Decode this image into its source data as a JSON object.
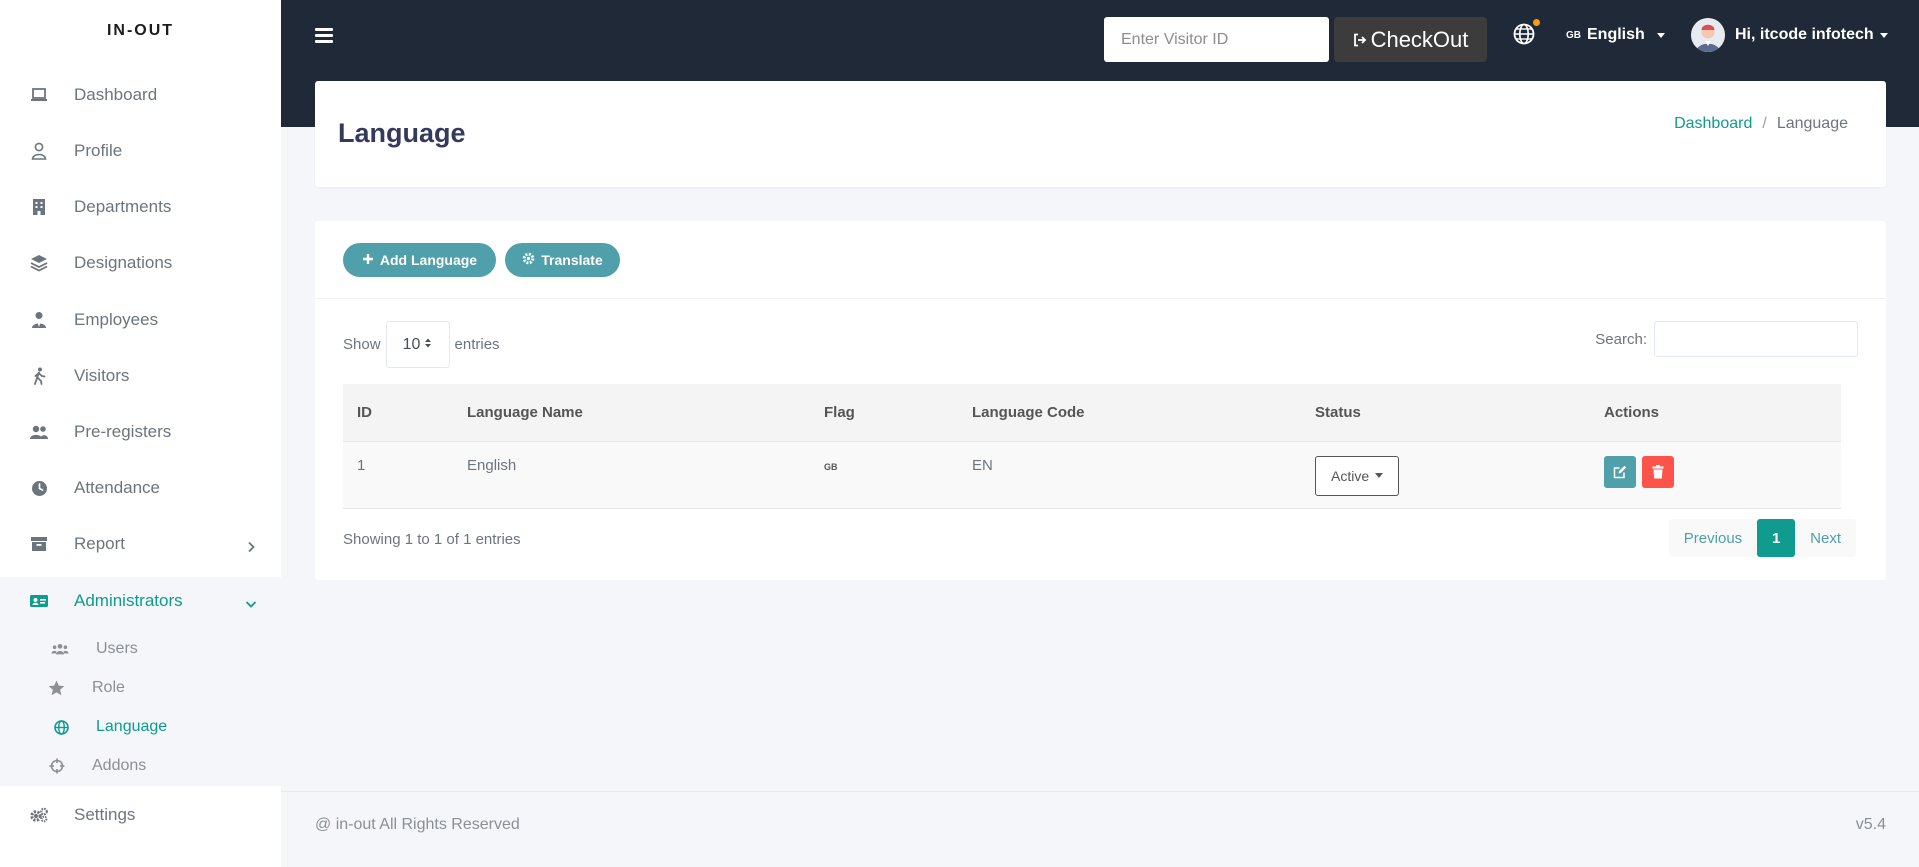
{
  "brand": "IN-OUT",
  "sidebar": {
    "items": [
      {
        "label": "Dashboard",
        "icon": "laptop-icon"
      },
      {
        "label": "Profile",
        "icon": "user-icon"
      },
      {
        "label": "Departments",
        "icon": "building-icon"
      },
      {
        "label": "Designations",
        "icon": "layers-icon"
      },
      {
        "label": "Employees",
        "icon": "user-tie-icon"
      },
      {
        "label": "Visitors",
        "icon": "walking-icon"
      },
      {
        "label": "Pre-registers",
        "icon": "users-icon"
      },
      {
        "label": "Attendance",
        "icon": "clock-icon"
      },
      {
        "label": "Report",
        "icon": "archive-icon"
      },
      {
        "label": "Administrators",
        "icon": "id-card-icon"
      },
      {
        "label": "Settings",
        "icon": "cogs-icon"
      }
    ],
    "sub_items": [
      {
        "label": "Users",
        "icon": "users-icon"
      },
      {
        "label": "Role",
        "icon": "star-icon"
      },
      {
        "label": "Language",
        "icon": "globe-icon"
      },
      {
        "label": "Addons",
        "icon": "crosshairs-icon"
      }
    ]
  },
  "header": {
    "visitor_placeholder": "Enter Visitor ID",
    "checkout_label": "CheckOut",
    "language_flag": "GB",
    "language_label": "English",
    "user_greeting": "Hi, itcode infotech"
  },
  "page": {
    "title": "Language",
    "breadcrumb": {
      "home": "Dashboard",
      "current": "Language"
    }
  },
  "card": {
    "add_language_label": "Add Language",
    "translate_label": "Translate",
    "show_label": "Show",
    "entries_value": "10",
    "entries_label": "entries",
    "search_label": "Search:"
  },
  "table": {
    "headers": [
      "ID",
      "Language Name",
      "Flag",
      "Language Code",
      "Status",
      "Actions"
    ],
    "rows": [
      {
        "id": "1",
        "name": "English",
        "flag": "GB",
        "code": "EN",
        "status": "Active"
      }
    ]
  },
  "pagination": {
    "info": "Showing 1 to 1 of 1 entries",
    "previous": "Previous",
    "current": "1",
    "next": "Next"
  },
  "footer": {
    "copyright": "@ in-out All Rights Reserved",
    "version": "v5.4"
  },
  "colors": {
    "accent": "#0f9b8e",
    "button_teal": "#4fa0aa",
    "header_dark": "#1f2937",
    "danger": "#fc544b"
  }
}
